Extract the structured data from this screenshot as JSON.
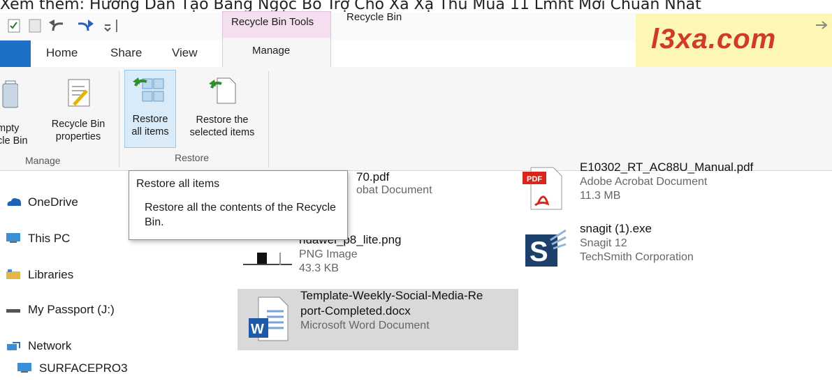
{
  "caption": "Xem thêm: Hướng Dẫn Tạo Bảng Ngọc Bổ Trợ Cho Xa Xạ Thủ Mùa 11 Lmht Mới Chuẩn Nhất",
  "watermark": "l3xa.com",
  "window_title": "Recycle Bin",
  "context_tab": {
    "header": "Recycle Bin Tools",
    "tab": "Manage"
  },
  "tabs": [
    "Home",
    "Share",
    "View"
  ],
  "ribbon": {
    "manage_group": {
      "label": "Manage",
      "empty_label_1": "mpty",
      "empty_label_2": "cle Bin",
      "properties_label_1": "Recycle Bin",
      "properties_label_2": "properties"
    },
    "restore_group": {
      "label": "Restore",
      "restore_all_1": "Restore",
      "restore_all_2": "all items",
      "restore_sel_1": "Restore the",
      "restore_sel_2": "selected items"
    }
  },
  "tooltip": {
    "title": "Restore all items",
    "body": "Restore all the contents of the Recycle Bin."
  },
  "nav": [
    "OneDrive",
    "This PC",
    "Libraries",
    "My Passport (J:)",
    "Network",
    "SURFACEPRO3"
  ],
  "files": [
    {
      "name": "70.pdf",
      "type": "obat Document",
      "size": ""
    },
    {
      "name": "E10302_RT_AC88U_Manual.pdf",
      "type": "Adobe Acrobat Document",
      "size": "11.3 MB"
    },
    {
      "name": "huawei_p8_lite.png",
      "type": "PNG Image",
      "size": "43.3 KB"
    },
    {
      "name": "snagit (1).exe",
      "type": "Snagit 12",
      "size": "TechSmith Corporation"
    },
    {
      "name_1": "Template-Weekly-Social-Media-Re",
      "name_2": "port-Completed.docx",
      "type": "Microsoft Word Document"
    }
  ],
  "colors": {
    "file_tab": "#1e6fc8",
    "context": "#f3dff0",
    "watermark_bg": "#fdf7b5",
    "watermark_fg": "#cf3b26",
    "selection": "#d9d9d9"
  }
}
